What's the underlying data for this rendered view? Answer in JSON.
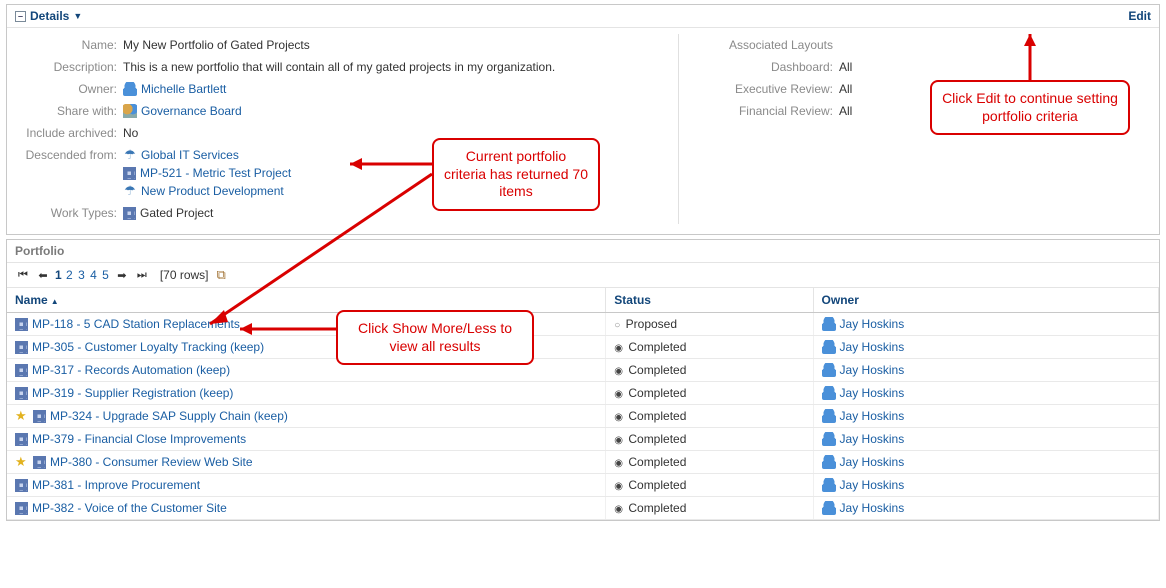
{
  "details": {
    "header_label": "Details",
    "edit_label": "Edit",
    "fields": {
      "name": {
        "label": "Name:",
        "value": "My New Portfolio of Gated Projects"
      },
      "description": {
        "label": "Description:",
        "value": "This is a new portfolio that will contain all of my gated projects in my organization."
      },
      "owner": {
        "label": "Owner:",
        "link": "Michelle Bartlett"
      },
      "share_with": {
        "label": "Share with:",
        "link": "Governance Board"
      },
      "include_archived": {
        "label": "Include archived:",
        "value": "No"
      },
      "descended_from": {
        "label": "Descended from:",
        "items": [
          {
            "icon": "umbrella",
            "text": "Global IT Services"
          },
          {
            "icon": "grid",
            "text": "MP-521 - Metric Test Project"
          },
          {
            "icon": "umbrella",
            "text": "New Product Development"
          }
        ]
      },
      "work_types": {
        "label": "Work Types:",
        "icon": "grid",
        "value": "Gated Project"
      }
    },
    "right": {
      "heading": "Associated Layouts",
      "rows": [
        {
          "label": "Dashboard:",
          "value": "All"
        },
        {
          "label": "Executive Review:",
          "value": "All"
        },
        {
          "label": "Financial Review:",
          "value": "All"
        }
      ]
    }
  },
  "portfolio": {
    "header": "Portfolio",
    "pager": {
      "pages": [
        "1",
        "2",
        "3",
        "4",
        "5"
      ],
      "current": "1",
      "rows_label": "[70 rows]"
    },
    "columns": {
      "name": "Name",
      "status": "Status",
      "owner": "Owner"
    },
    "rows": [
      {
        "name": "MP-118 - 5 CAD Station Replacements",
        "status": "Proposed",
        "owner": "Jay Hoskins",
        "starred": false
      },
      {
        "name": "MP-305 - Customer Loyalty Tracking (keep)",
        "status": "Completed",
        "owner": "Jay Hoskins",
        "starred": false
      },
      {
        "name": "MP-317 - Records Automation (keep)",
        "status": "Completed",
        "owner": "Jay Hoskins",
        "starred": false
      },
      {
        "name": "MP-319 - Supplier Registration (keep)",
        "status": "Completed",
        "owner": "Jay Hoskins",
        "starred": false
      },
      {
        "name": "MP-324 - Upgrade SAP Supply Chain (keep)",
        "status": "Completed",
        "owner": "Jay Hoskins",
        "starred": true
      },
      {
        "name": "MP-379 - Financial Close Improvements",
        "status": "Completed",
        "owner": "Jay Hoskins",
        "starred": false
      },
      {
        "name": "MP-380 - Consumer Review Web Site",
        "status": "Completed",
        "owner": "Jay Hoskins",
        "starred": true
      },
      {
        "name": "MP-381 - Improve Procurement",
        "status": "Completed",
        "owner": "Jay Hoskins",
        "starred": false
      },
      {
        "name": "MP-382 - Voice of the Customer Site",
        "status": "Completed",
        "owner": "Jay Hoskins",
        "starred": false
      }
    ]
  },
  "callouts": {
    "criteria": "Current portfolio  criteria has returned 70  items",
    "edit_hint": "Click Edit to continue setting portfolio criteria",
    "showmore": "Click Show More/Less to view all results"
  }
}
